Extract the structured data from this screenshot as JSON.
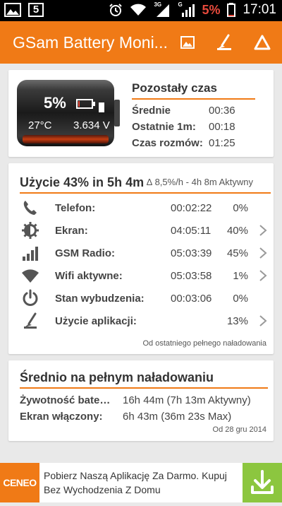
{
  "status_bar": {
    "notification_count": "5",
    "battery_percent": "5%",
    "clock": "17:01",
    "network_3g": "3G",
    "network_g": "G"
  },
  "app_bar": {
    "title": "GSam Battery Moni...",
    "accent_color": "#f07a16"
  },
  "summary": {
    "battery_percent": "5%",
    "temperature": "27°C",
    "voltage": "3.634 V",
    "battery_level": 0.05,
    "title": "Pozostały czas",
    "rows": [
      {
        "label": "Średnie",
        "value": "00:36"
      },
      {
        "label": "Ostatnie 1m:",
        "value": "00:18"
      },
      {
        "label": "Czas rozmów:",
        "value": "01:25"
      }
    ]
  },
  "usage": {
    "title": "Użycie 43% in 5h 4m",
    "subtitle": "∆ 8,5%/h - 4h 8m Aktywny",
    "rows": [
      {
        "icon": "phone-icon",
        "label": "Telefon:",
        "time": "00:02:22",
        "pct": "0%",
        "chevron": false
      },
      {
        "icon": "screen-icon",
        "label": "Ekran:",
        "time": "04:05:11",
        "pct": "40%",
        "chevron": true
      },
      {
        "icon": "signal-bars-icon",
        "label": "GSM Radio:",
        "time": "05:03:39",
        "pct": "45%",
        "chevron": true
      },
      {
        "icon": "wifi-icon",
        "label": "Wifi aktywne:",
        "time": "05:03:58",
        "pct": "1%",
        "chevron": true
      },
      {
        "icon": "power-icon",
        "label": "Stan wybudzenia:",
        "time": "00:03:06",
        "pct": "0%",
        "chevron": false
      },
      {
        "icon": "apps-icon",
        "label": "Użycie aplikacji:",
        "time": "",
        "pct": "13%",
        "chevron": true
      }
    ],
    "footer": "Od ostatniego pełnego naładowania"
  },
  "average": {
    "title": "Średnio na pełnym naładowaniu",
    "rows": [
      {
        "label": "Żywotność bate…",
        "value": "16h 44m (7h 13m Aktywny)"
      },
      {
        "label": "Ekran włączony:",
        "value": "6h 43m (36m 23s Max)"
      }
    ],
    "footer": "Od 28 gru 2014"
  },
  "ad": {
    "logo": "CENEO",
    "text": "Pobierz Naszą Aplikację Za Darmo. Kupuj Bez Wychodzenia Z Domu",
    "button_color": "#8cc63f"
  }
}
